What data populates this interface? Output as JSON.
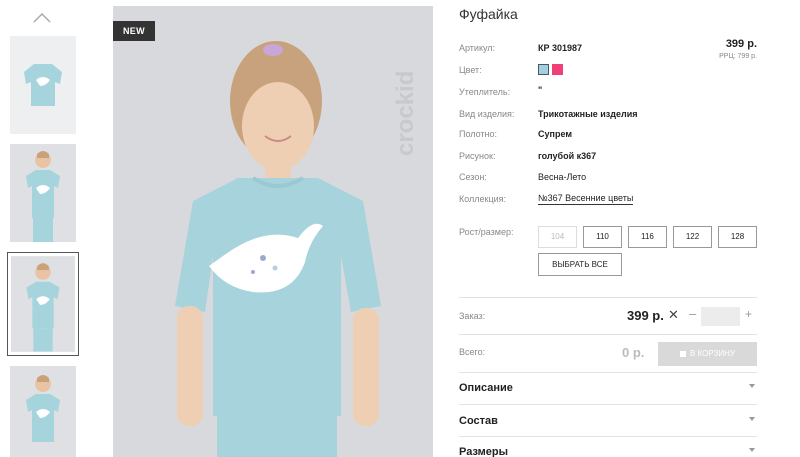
{
  "badge": "NEW",
  "watermark": "crockid",
  "product": {
    "title": "Фуфайка",
    "price": "399 р.",
    "rrc": "РРЦ: 799 р.",
    "attributes": [
      {
        "label": "Артикул:",
        "value": "КР 301987"
      },
      {
        "label": "Цвет:",
        "value": ""
      },
      {
        "label": "Утеплитель:",
        "value": "\""
      },
      {
        "label": "Вид изделия:",
        "value": "Трикотажные изделия"
      },
      {
        "label": "Полотно:",
        "value": "Супрем"
      },
      {
        "label": "Рисунок:",
        "value": "голубой к367"
      },
      {
        "label": "Сезон:",
        "value": "Весна-Лето"
      },
      {
        "label": "Коллекция:",
        "value": "№367 Весенние цветы"
      }
    ],
    "colors": [
      "#9fd0e3",
      "#f0407a"
    ]
  },
  "sizes": {
    "label": "Рост/размер:",
    "options": [
      "104",
      "110",
      "116",
      "122",
      "128"
    ],
    "select_all": "ВЫБРАТЬ ВСЕ"
  },
  "order": {
    "label": "Заказ:",
    "price": "399 р.",
    "times": "✕",
    "minus": "–",
    "plus": "+",
    "total_label": "Всего:",
    "total_value": "0 р.",
    "cart_button": "В КОРЗИНУ"
  },
  "accordion": [
    "Описание",
    "Состав",
    "Размеры"
  ]
}
